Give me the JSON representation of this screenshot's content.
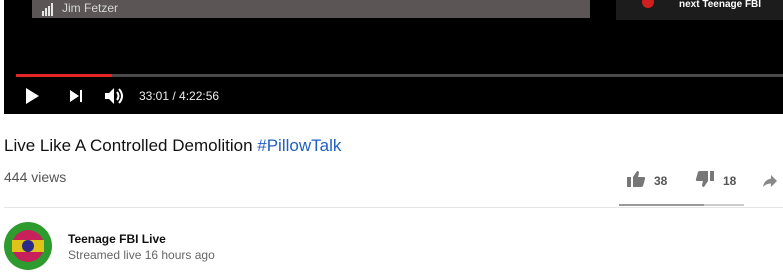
{
  "player": {
    "speaker_name": "Jim Fetzer",
    "up_next_label": "next Teenage FBI",
    "progress_fraction": 0.125,
    "time_display": "33:01 / 4:22:56",
    "accent_color": "#e32525",
    "icons": [
      "signal-icon",
      "play-icon",
      "next-icon",
      "volume-icon"
    ]
  },
  "video": {
    "title": "Live Like A Controlled Demolition",
    "hashtag": "#PillowTalk",
    "views": "444 views"
  },
  "actions": {
    "like_count": "38",
    "dislike_count": "18",
    "like_fraction": 0.68,
    "icons": [
      "thumbs-up-icon",
      "thumbs-down-icon",
      "share-icon"
    ]
  },
  "channel": {
    "name": "Teenage FBI Live",
    "stream_info": "Streamed live 16 hours ago",
    "avatar_colors": [
      "#2e9b2e",
      "#c8205a",
      "#e0c21a",
      "#2a2a8a"
    ]
  }
}
